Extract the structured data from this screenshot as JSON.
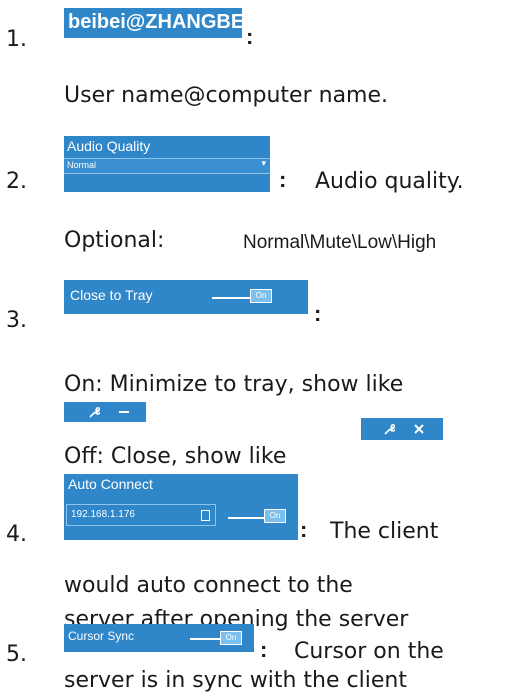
{
  "items": [
    {
      "number": "1.",
      "widget": {
        "text": "beibei@ZHANGBEIBEI"
      },
      "colon": ":",
      "description": "User name@computer name."
    },
    {
      "number": "2.",
      "widget": {
        "label": "Audio Quality",
        "selected": "Normal"
      },
      "colon": ":",
      "description": "Audio quality.",
      "options_prefix": "Optional:",
      "options": "Normal\\Mute\\Low\\High"
    },
    {
      "number": "3.",
      "widget": {
        "label": "Close to Tray",
        "toggle": "On"
      },
      "colon": ":",
      "on_text": "On: Minimize to tray, show like",
      "off_text": "Off: Close, show like"
    },
    {
      "number": "4.",
      "widget": {
        "label": "Auto Connect",
        "ip": "192.168.1.176",
        "toggle": "On"
      },
      "colon": ":",
      "description_lines": [
        "The client",
        "would auto connect to the",
        "server after opening the server"
      ]
    },
    {
      "number": "5.",
      "widget": {
        "label": "Cursor Sync",
        "toggle": "On"
      },
      "colon": ":",
      "description_lines": [
        "Cursor on the",
        "server is in sync with the client"
      ]
    }
  ],
  "icons": {
    "tray_on": [
      "wrench-icon",
      "minimize-icon"
    ],
    "tray_off": [
      "wrench-icon",
      "close-icon"
    ]
  },
  "colors": {
    "widget_blue": "#2f86c8",
    "toggle_knob": "#7cc0ef"
  }
}
